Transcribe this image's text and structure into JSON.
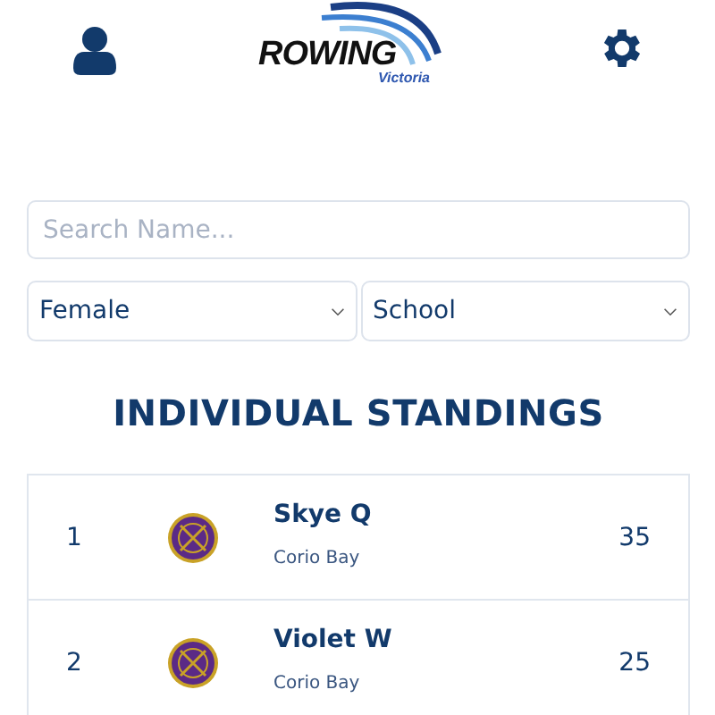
{
  "header": {
    "logo": {
      "title": "ROWING",
      "subtitle": "Victoria"
    }
  },
  "search": {
    "placeholder": "Search Name..."
  },
  "filters": [
    {
      "value": "Female"
    },
    {
      "value": "School"
    }
  ],
  "heading": "INDIVIDUAL STANDINGS",
  "standings": [
    {
      "rank": "1",
      "name": "Skye Q",
      "club": "Corio Bay",
      "points": "35"
    },
    {
      "rank": "2",
      "name": "Violet W",
      "club": "Corio Bay",
      "points": "25"
    }
  ]
}
